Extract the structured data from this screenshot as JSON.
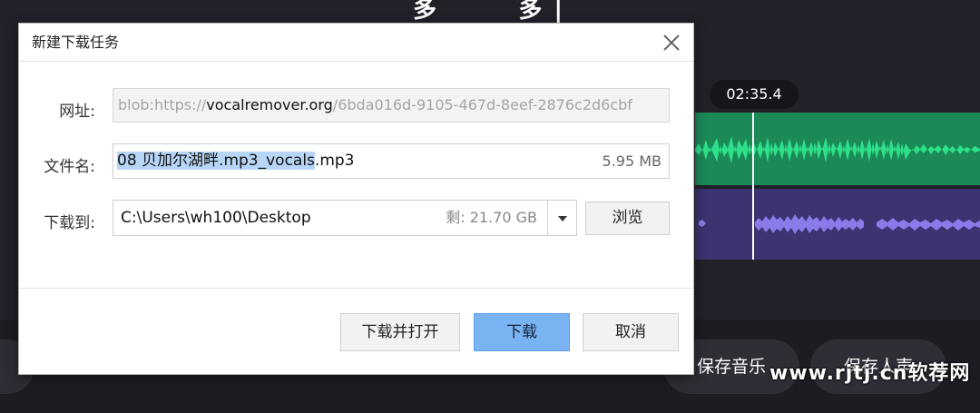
{
  "background": {
    "title_fragment": "多        多 |",
    "timestamp": "02:35.4",
    "buttons": {
      "save_music": "保存音乐",
      "save_voice": "保存人声"
    },
    "watermark": "www.rjtj.cn软荐网"
  },
  "dialog": {
    "title": "新建下载任务",
    "url": {
      "label": "网址:",
      "prefix": "blob:https://",
      "domain": "vocalremover.org",
      "suffix": "/6bda016d-9105-467d-8eef-2876c2d6cbf"
    },
    "filename": {
      "label": "文件名:",
      "selected": "08 贝加尔湖畔.mp3_vocals",
      "rest": ".mp3",
      "size": "5.95 MB"
    },
    "destination": {
      "label": "下载到:",
      "path": "C:\\Users\\wh100\\Desktop",
      "free": "剩: 21.70 GB",
      "browse": "浏览"
    },
    "buttons": {
      "download_open": "下载并打开",
      "download": "下载",
      "cancel": "取消"
    }
  },
  "colors": {
    "vocal_track": "#1b8a57",
    "vocal_wave": "#2ee08a",
    "music_track": "#3b3470",
    "music_wave": "#8a7bea",
    "primary_button": "#79b3f2",
    "selection": "#b7d6f7"
  },
  "icons": {
    "close": "close-icon",
    "dropdown": "chevron-down-icon"
  }
}
